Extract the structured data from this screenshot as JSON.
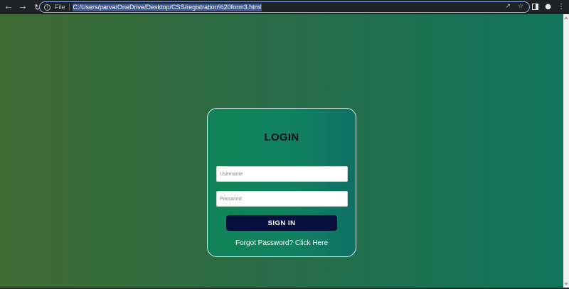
{
  "browser": {
    "url_scheme_label": "File",
    "url": "C:/Users/parva/OneDrive/Desktop/CSS/registration%20form3.html",
    "icons": {
      "back": "arrow-left-icon",
      "forward": "arrow-right-icon",
      "reload": "reload-icon",
      "info": "info-icon",
      "share": "share-icon",
      "bookmark": "star-icon",
      "side_panel": "side-panel-icon",
      "profile": "profile-icon",
      "menu": "kebab-menu-icon"
    }
  },
  "page": {
    "background_colors": [
      "#3f6b33",
      "#10755c"
    ]
  },
  "login": {
    "title": "LOGIN",
    "username_placeholder": "Username",
    "username_value": "",
    "password_placeholder": "Password",
    "password_value": "",
    "sign_in_label": "SIGN IN",
    "forgot_link": "Forgot Password? Click Here",
    "button_color": "#070f3c"
  }
}
